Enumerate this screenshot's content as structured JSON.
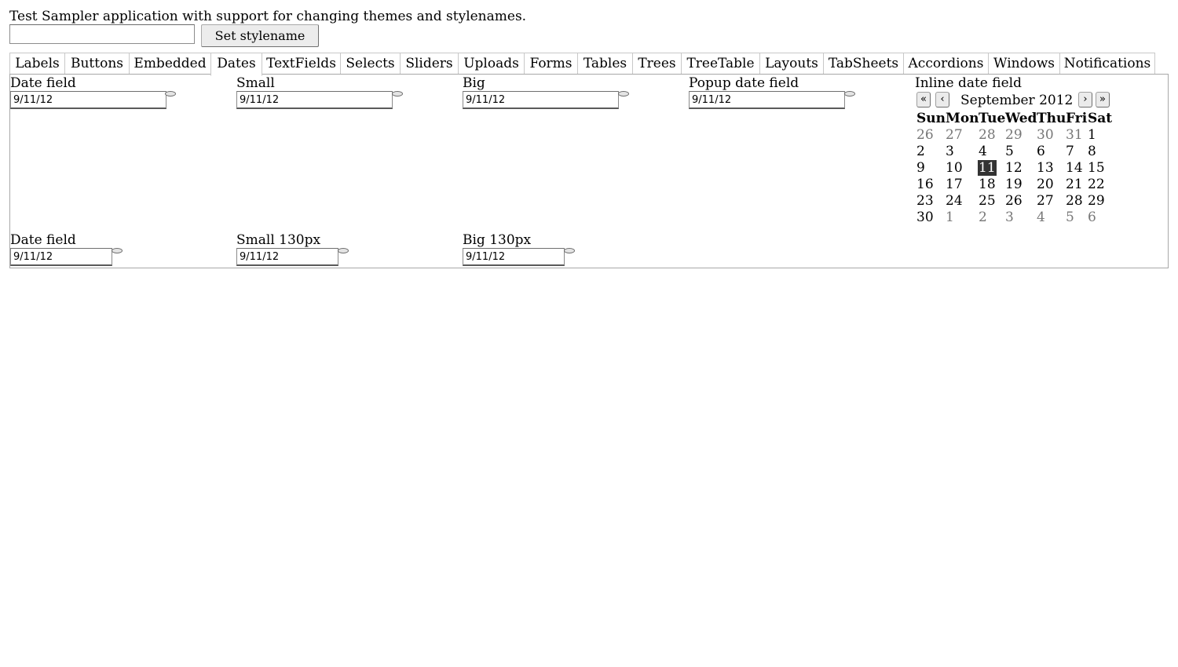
{
  "intro_text": "Test Sampler application with support for changing themes and stylenames.",
  "stylename_input": {
    "value": ""
  },
  "set_stylename_button": "Set stylename",
  "tabs": [
    {
      "label": "Labels"
    },
    {
      "label": "Buttons"
    },
    {
      "label": "Embedded"
    },
    {
      "label": "Dates",
      "selected": true
    },
    {
      "label": "TextFields"
    },
    {
      "label": "Selects"
    },
    {
      "label": "Sliders"
    },
    {
      "label": "Uploads"
    },
    {
      "label": "Forms"
    },
    {
      "label": "Tables"
    },
    {
      "label": "Trees"
    },
    {
      "label": "TreeTable"
    },
    {
      "label": "Layouts"
    },
    {
      "label": "TabSheets"
    },
    {
      "label": "Accordions"
    },
    {
      "label": "Windows"
    },
    {
      "label": "Notifications"
    }
  ],
  "fields_row1": [
    {
      "caption": "Date field",
      "value": "9/11/12"
    },
    {
      "caption": "Small",
      "value": "9/11/12"
    },
    {
      "caption": "Big",
      "value": "9/11/12"
    },
    {
      "caption": "Popup date field",
      "value": "9/11/12"
    }
  ],
  "inline": {
    "caption": "Inline date field",
    "month_label": "September 2012",
    "nav": {
      "prev_year": "«",
      "prev_month": "‹",
      "next_month": "›",
      "next_year": "»"
    },
    "weekdays": [
      "Sun",
      "Mon",
      "Tue",
      "Wed",
      "Thu",
      "Fri",
      "Sat"
    ],
    "weeks": [
      [
        "26",
        "27",
        "28",
        "29",
        "30",
        "31",
        "1"
      ],
      [
        "2",
        "3",
        "4",
        "5",
        "6",
        "7",
        "8"
      ],
      [
        "9",
        "10",
        "11",
        "12",
        "13",
        "14",
        "15"
      ],
      [
        "16",
        "17",
        "18",
        "19",
        "20",
        "21",
        "22"
      ],
      [
        "23",
        "24",
        "25",
        "26",
        "27",
        "28",
        "29"
      ],
      [
        "30",
        "1",
        "2",
        "3",
        "4",
        "5",
        "6"
      ]
    ],
    "selected_day": "11"
  },
  "fields_row2": [
    {
      "caption": "Date field",
      "value": "9/11/12"
    },
    {
      "caption": "Small 130px",
      "value": "9/11/12"
    },
    {
      "caption": "Big 130px",
      "value": "9/11/12"
    }
  ]
}
